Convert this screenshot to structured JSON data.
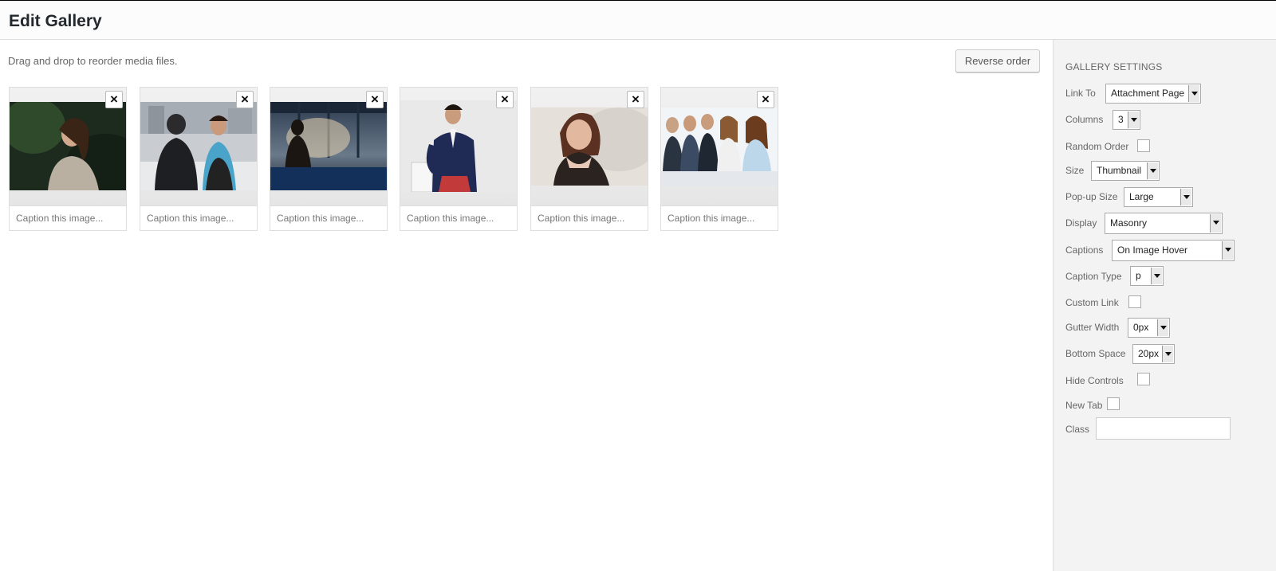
{
  "header": {
    "title": "Edit Gallery"
  },
  "main": {
    "instructions": "Drag and drop to reorder media files.",
    "reverse_label": "Reverse order",
    "remove_icon": "×",
    "items": [
      {
        "caption_placeholder": "Caption this image..."
      },
      {
        "caption_placeholder": "Caption this image..."
      },
      {
        "caption_placeholder": "Caption this image..."
      },
      {
        "caption_placeholder": "Caption this image..."
      },
      {
        "caption_placeholder": "Caption this image..."
      },
      {
        "caption_placeholder": "Caption this image..."
      }
    ]
  },
  "sidebar": {
    "title": "GALLERY SETTINGS",
    "link_to": {
      "label": "Link To",
      "value": "Attachment Page"
    },
    "columns": {
      "label": "Columns",
      "value": "3"
    },
    "random_order": {
      "label": "Random Order",
      "checked": false
    },
    "size": {
      "label": "Size",
      "value": "Thumbnail"
    },
    "popup_size": {
      "label": "Pop-up Size",
      "value": "Large"
    },
    "display": {
      "label": "Display",
      "value": "Masonry"
    },
    "captions": {
      "label": "Captions",
      "value": "On Image Hover"
    },
    "caption_type": {
      "label": "Caption Type",
      "value": "p"
    },
    "custom_link": {
      "label": "Custom Link",
      "checked": false
    },
    "gutter_width": {
      "label": "Gutter Width",
      "value": "0px"
    },
    "bottom_space": {
      "label": "Bottom Space",
      "value": "20px"
    },
    "hide_controls": {
      "label": "Hide Controls",
      "checked": false
    },
    "new_tab": {
      "label": "New Tab",
      "checked": false
    },
    "class": {
      "label": "Class",
      "value": ""
    }
  }
}
